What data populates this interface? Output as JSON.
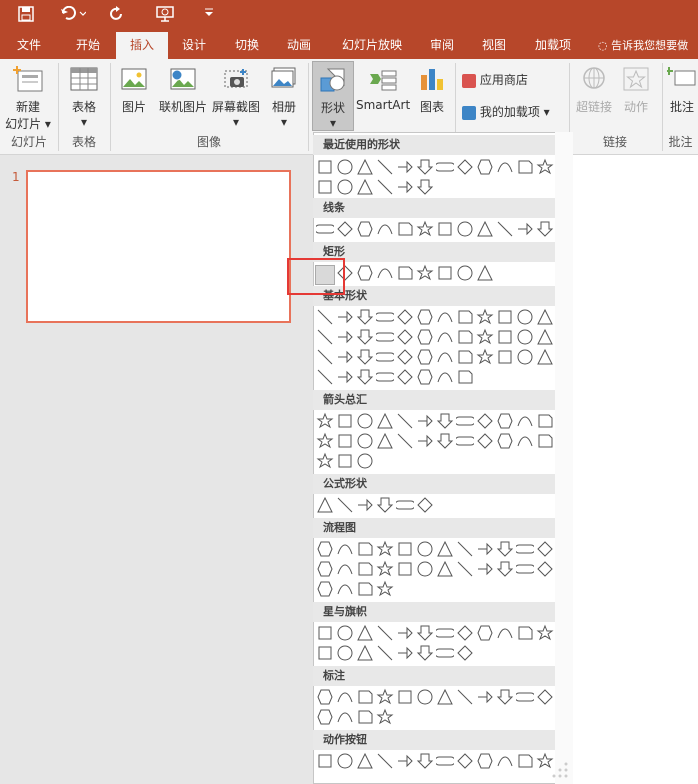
{
  "quick_access": {
    "save_icon": "save-icon",
    "undo_icon": "undo-icon",
    "redo_icon": "redo-icon",
    "present_icon": "present-icon"
  },
  "tabs": [
    "文件",
    "开始",
    "插入",
    "设计",
    "切换",
    "动画",
    "幻灯片放映",
    "审阅",
    "视图",
    "加载项"
  ],
  "active_tab": "插入",
  "tell_me": "告诉我您想要做",
  "ribbon": {
    "new_slide_line1": "新建",
    "new_slide_line2": "幻灯片",
    "table": "表格",
    "picture": "图片",
    "online_picture": "联机图片",
    "screenshot": "屏幕截图",
    "album": "相册",
    "shapes": "形状",
    "smartart": "SmartArt",
    "chart": "图表",
    "store": "应用商店",
    "my_addins": "我的加载项",
    "hyperlink": "超链接",
    "action": "动作",
    "comment": "批注",
    "groups": {
      "slides": "幻灯片",
      "tables": "表格",
      "images": "图像",
      "links": "链接",
      "comments": "批注"
    }
  },
  "slide": {
    "number": "1"
  },
  "shapes_menu": {
    "sections": [
      "最近使用的形状",
      "线条",
      "矩形",
      "基本形状",
      "箭头总汇",
      "公式形状",
      "流程图",
      "星与旗帜",
      "标注",
      "动作按钮"
    ]
  }
}
